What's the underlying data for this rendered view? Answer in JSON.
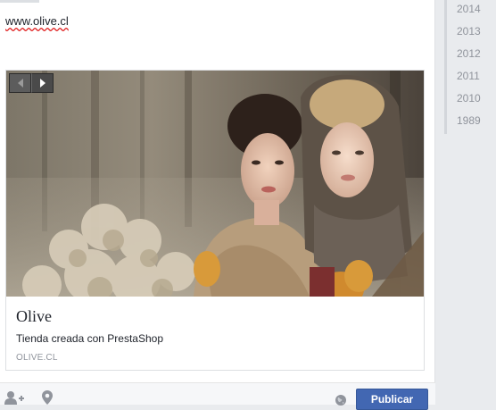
{
  "composer": {
    "url_text": "www.olive.cl"
  },
  "link_preview": {
    "title": "Olive",
    "description": "Tienda creada con PrestaShop",
    "domain": "OLIVE.CL",
    "nav_prev_icon": "chevron-left-icon",
    "nav_next_icon": "chevron-right-icon"
  },
  "toolbar": {
    "tag_people_icon": "tag-people-icon",
    "location_icon": "location-pin-icon",
    "audience_icon": "globe-icon",
    "publish_label": "Publicar"
  },
  "timeline_years": [
    "2014",
    "2013",
    "2012",
    "2011",
    "2010",
    "1989"
  ],
  "colors": {
    "publish_button": "#4267b2",
    "year_text": "#90949c",
    "background": "#e9ebee"
  }
}
